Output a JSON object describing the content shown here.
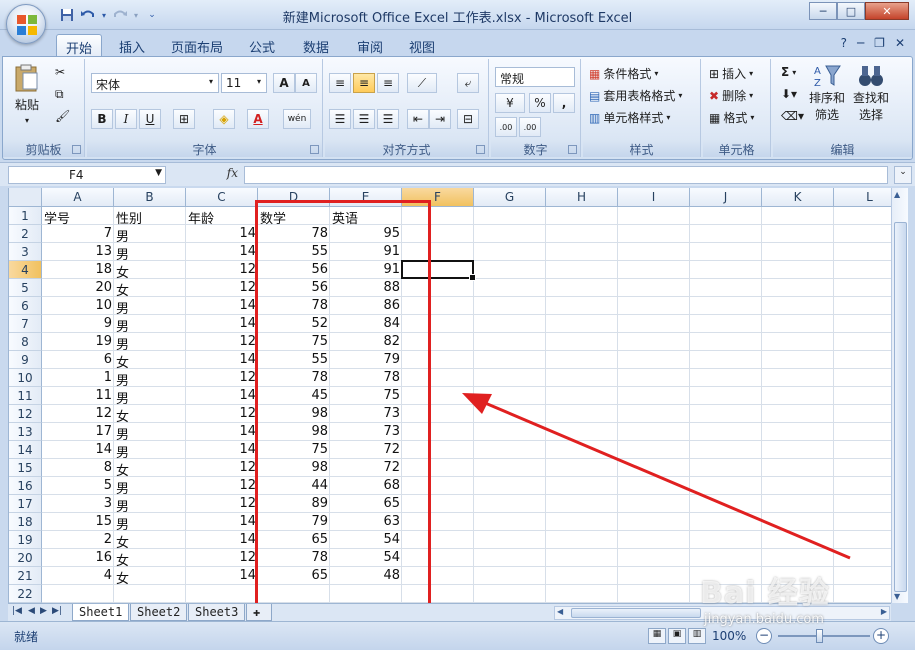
{
  "window": {
    "title": "新建Microsoft Office Excel 工作表.xlsx - Microsoft Excel",
    "min": "─",
    "max": "□",
    "close": "✕"
  },
  "tabs": [
    "开始",
    "插入",
    "页面布局",
    "公式",
    "数据",
    "审阅",
    "视图"
  ],
  "ribbon": {
    "clipboard": {
      "paste": "粘贴",
      "label": "剪贴板"
    },
    "font": {
      "name": "宋体",
      "size": "11",
      "label": "字体",
      "bold": "B",
      "italic": "I",
      "underline": "U",
      "grow": "A",
      "shrink": "A",
      "fontcolor": "A",
      "phonetic": "wén"
    },
    "alignment": {
      "label": "对齐方式"
    },
    "number": {
      "format": "常规",
      "percent": "%",
      "comma": ",",
      "inc": ".00",
      "dec": ".00",
      "label": "数字"
    },
    "styles": {
      "conditional": "条件格式",
      "table": "套用表格格式",
      "cell": "单元格样式",
      "label": "样式"
    },
    "cells": {
      "insert": "插入",
      "delete": "删除",
      "format": "格式",
      "label": "单元格"
    },
    "editing": {
      "sum": "Σ",
      "sort": "排序和",
      "sort2": "筛选",
      "find": "查找和",
      "find2": "选择",
      "label": "编辑"
    }
  },
  "formula": {
    "namebox": "F4",
    "fx": "fx",
    "value": ""
  },
  "columns": [
    "A",
    "B",
    "C",
    "D",
    "E",
    "F",
    "G",
    "H",
    "I",
    "J",
    "K",
    "L"
  ],
  "selected_cell": {
    "col": "F",
    "row": "4"
  },
  "rows": [
    [
      "学号",
      "性别",
      "年龄",
      "数学",
      "英语"
    ],
    [
      "7",
      "男",
      "14",
      "78",
      "95"
    ],
    [
      "13",
      "男",
      "14",
      "55",
      "91"
    ],
    [
      "18",
      "女",
      "12",
      "56",
      "91"
    ],
    [
      "20",
      "女",
      "12",
      "56",
      "88"
    ],
    [
      "10",
      "男",
      "14",
      "78",
      "86"
    ],
    [
      "9",
      "男",
      "14",
      "52",
      "84"
    ],
    [
      "19",
      "男",
      "12",
      "75",
      "82"
    ],
    [
      "6",
      "女",
      "14",
      "55",
      "79"
    ],
    [
      "1",
      "男",
      "12",
      "78",
      "78"
    ],
    [
      "11",
      "男",
      "14",
      "45",
      "75"
    ],
    [
      "12",
      "女",
      "12",
      "98",
      "73"
    ],
    [
      "17",
      "男",
      "14",
      "98",
      "73"
    ],
    [
      "14",
      "男",
      "14",
      "75",
      "72"
    ],
    [
      "8",
      "女",
      "12",
      "98",
      "72"
    ],
    [
      "5",
      "男",
      "12",
      "44",
      "68"
    ],
    [
      "3",
      "男",
      "12",
      "89",
      "65"
    ],
    [
      "15",
      "男",
      "14",
      "79",
      "63"
    ],
    [
      "2",
      "女",
      "14",
      "65",
      "54"
    ],
    [
      "16",
      "女",
      "12",
      "78",
      "54"
    ],
    [
      "4",
      "女",
      "14",
      "65",
      "48"
    ],
    [
      "",
      "",
      "",
      "",
      ""
    ]
  ],
  "sheets": [
    "Sheet1",
    "Sheet2",
    "Sheet3"
  ],
  "status": {
    "ready": "就绪",
    "zoom": "100%"
  },
  "watermark": {
    "brand": "Bai 经验",
    "url": "jingyan.baidu.com"
  },
  "colors": {
    "highlight_box": "#e02020",
    "ribbon_bg": "#dbe6f4"
  }
}
